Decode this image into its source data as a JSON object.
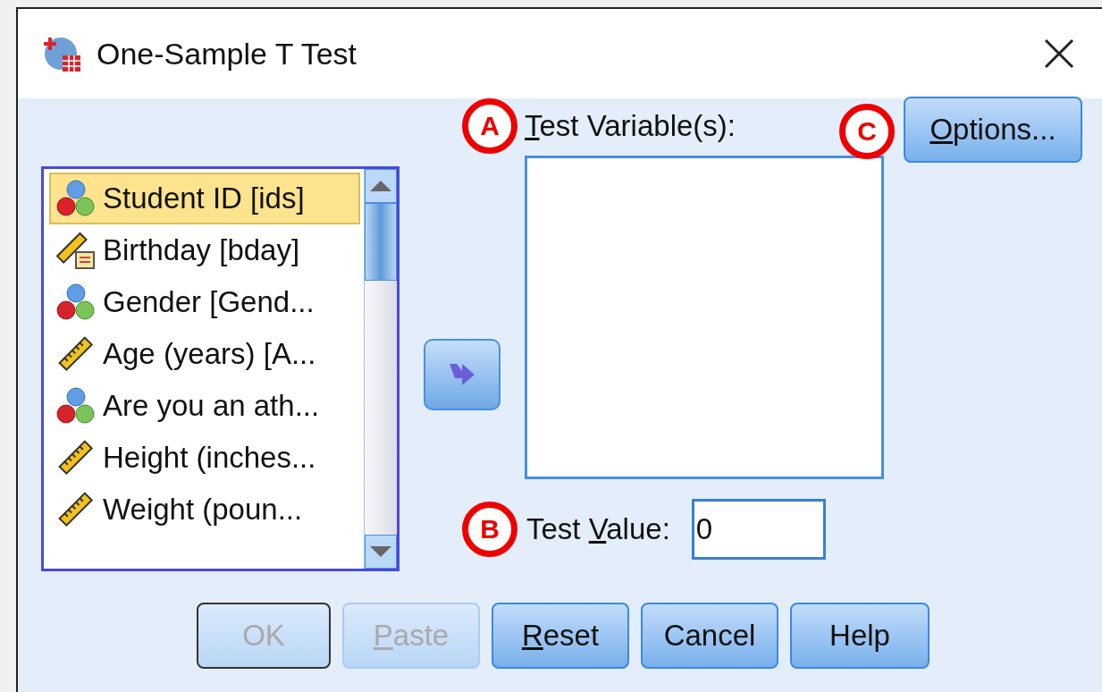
{
  "window": {
    "title": "One-Sample T Test"
  },
  "variables": [
    {
      "kind": "nominal",
      "label": "Student ID [ids]",
      "selected": true
    },
    {
      "kind": "date",
      "label": "Birthday [bday]",
      "selected": false
    },
    {
      "kind": "nominal",
      "label": "Gender [Gend...",
      "selected": false
    },
    {
      "kind": "scale",
      "label": "Age (years) [A...",
      "selected": false
    },
    {
      "kind": "nominal",
      "label": "Are you an ath...",
      "selected": false
    },
    {
      "kind": "scale",
      "label": "Height (inches...",
      "selected": false
    },
    {
      "kind": "scale",
      "label": "Weight (poun...",
      "selected": false
    }
  ],
  "test_variables": {
    "annotation": "A",
    "label_key": "T",
    "label_rest": "est Variable(s):"
  },
  "options_button": {
    "annotation": "C",
    "label_key": "O",
    "label_rest": "ptions..."
  },
  "test_value": {
    "annotation": "B",
    "label_before": "Test ",
    "label_key": "V",
    "label_rest": "alue:",
    "value": "0"
  },
  "buttons": [
    {
      "label_rest": "OK",
      "disabled": true,
      "default": true
    },
    {
      "label_key": "P",
      "label_rest": "aste",
      "disabled": true,
      "default": false
    },
    {
      "label_key": "R",
      "label_rest": "eset",
      "disabled": false,
      "default": false
    },
    {
      "label_rest": "Cancel",
      "disabled": false,
      "default": false
    },
    {
      "label_rest": "Help",
      "disabled": false,
      "default": false
    }
  ]
}
